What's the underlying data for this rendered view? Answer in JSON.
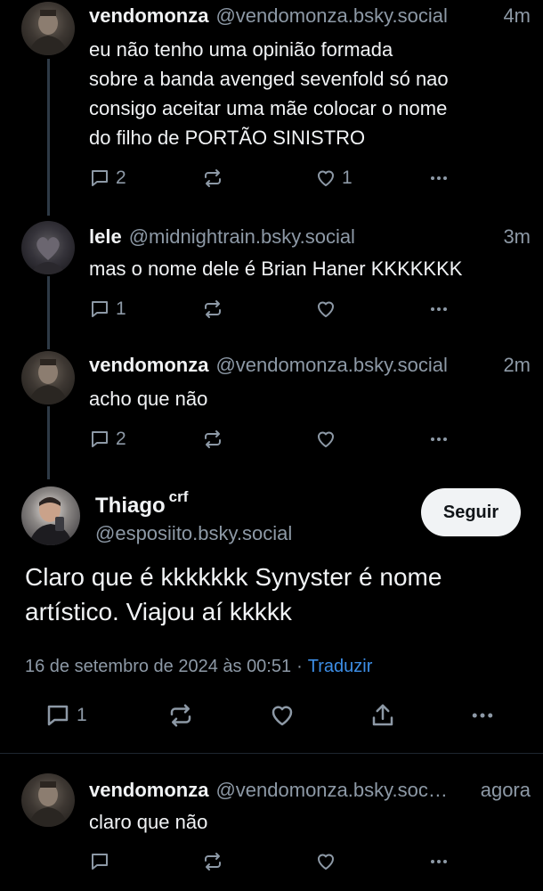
{
  "posts": [
    {
      "name": "vendomonza",
      "handle": "@vendomonza.bsky.social",
      "time": "4m",
      "lines": [
        "eu não tenho uma opinião formada",
        "sobre a banda avenged sevenfold só nao",
        "consigo aceitar uma mãe colocar o nome",
        "do filho de PORTÃO SINISTRO"
      ],
      "replies": "2",
      "likes": "1"
    },
    {
      "name": "lele",
      "handle": "@midnightrain.bsky.social",
      "time": "3m",
      "lines": [
        "mas o nome dele é Brian Haner KKKKKKK"
      ],
      "replies": "1",
      "likes": ""
    },
    {
      "name": "vendomonza",
      "handle": "@vendomonza.bsky.social",
      "time": "2m",
      "lines": [
        "acho que não"
      ],
      "replies": "2",
      "likes": ""
    }
  ],
  "main_post": {
    "name": "Thiago",
    "name_suffix": "crf",
    "handle": "@esposiito.bsky.social",
    "follow_label": "Seguir",
    "lines": [
      "Claro que é kkkkkkk Synyster é nome",
      "artístico. Viajou aí kkkkk"
    ],
    "date": "16 de setembro de 2024 às 00:51",
    "separator": "·",
    "translate_label": "Traduzir",
    "replies": "1"
  },
  "reply_post": {
    "name": "vendomonza",
    "handle": "@vendomonza.bsky.soc…",
    "time": "agora",
    "lines": [
      "claro que não"
    ]
  },
  "icons": {
    "reply": "reply-icon",
    "repost": "repost-icon",
    "like": "heart-icon",
    "share": "share-icon",
    "more": "more-icon"
  },
  "colors": {
    "background": "#000000",
    "text": "#f1f3f5",
    "muted": "#8d99a6",
    "link": "#3d8ee6",
    "thread_line": "#2e3a46"
  }
}
